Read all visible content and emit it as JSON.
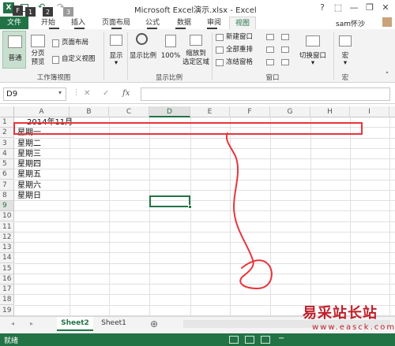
{
  "titlebar": {
    "title": "Microsoft Excel演示.xlsx - Excel",
    "help": "?",
    "minimize": "—",
    "restore": "❐",
    "close": "✕"
  },
  "tabs": [
    {
      "label": "文件",
      "key": "F"
    },
    {
      "label": "开始",
      "key": "H"
    },
    {
      "label": "插入",
      "key": "N"
    },
    {
      "label": "页面布局",
      "key": "P"
    },
    {
      "label": "公式",
      "key": "M"
    },
    {
      "label": "数据",
      "key": "A"
    },
    {
      "label": "审阅",
      "key": "R"
    },
    {
      "label": "视图",
      "key": ""
    }
  ],
  "qat_keytips": [
    "1",
    "2",
    "3"
  ],
  "user": "sam怀沙",
  "ribbon": {
    "normal": "普通",
    "page_break": "分页\n预览",
    "page_layout": "页面布局",
    "custom_views": "自定义视图",
    "group_workbook_views": "工作簿视图",
    "show": "显示",
    "zoom": "显示比例",
    "zoom100": "100%",
    "zoom_selection": "缩放到\n选定区域",
    "group_zoom": "显示比例",
    "new_window": "新建窗口",
    "arrange_all": "全部重排",
    "freeze_panes": "冻结窗格",
    "switch_windows": "切换窗口",
    "group_window": "窗口",
    "macros": "宏",
    "group_macros": "宏"
  },
  "formula_bar": {
    "name_box": "D9",
    "cancel": "✕",
    "enter": "✓",
    "fx": "fx",
    "formula": ""
  },
  "columns": [
    "A",
    "B",
    "C",
    "D",
    "E",
    "F",
    "G",
    "H",
    "I"
  ],
  "selected_column": "D",
  "rows": [
    "1",
    "2",
    "3",
    "4",
    "5",
    "6",
    "7",
    "8",
    "9",
    "10",
    "11",
    "12",
    "13",
    "14",
    "15",
    "16",
    "17",
    "18",
    "19"
  ],
  "selected_row": "9",
  "cells_a": [
    "2014年11月",
    "星期一",
    "星期二",
    "星期三",
    "星期四",
    "星期五",
    "星期六",
    "星期日"
  ],
  "sheets": [
    {
      "name": "Sheet2",
      "active": true
    },
    {
      "name": "Sheet1",
      "active": false
    }
  ],
  "add_sheet": "⊕",
  "status": "就绪",
  "annotation_color": "#e8353b",
  "accent": "#217346",
  "watermark": "易采站长站",
  "watermark_url": "www.easck.com"
}
